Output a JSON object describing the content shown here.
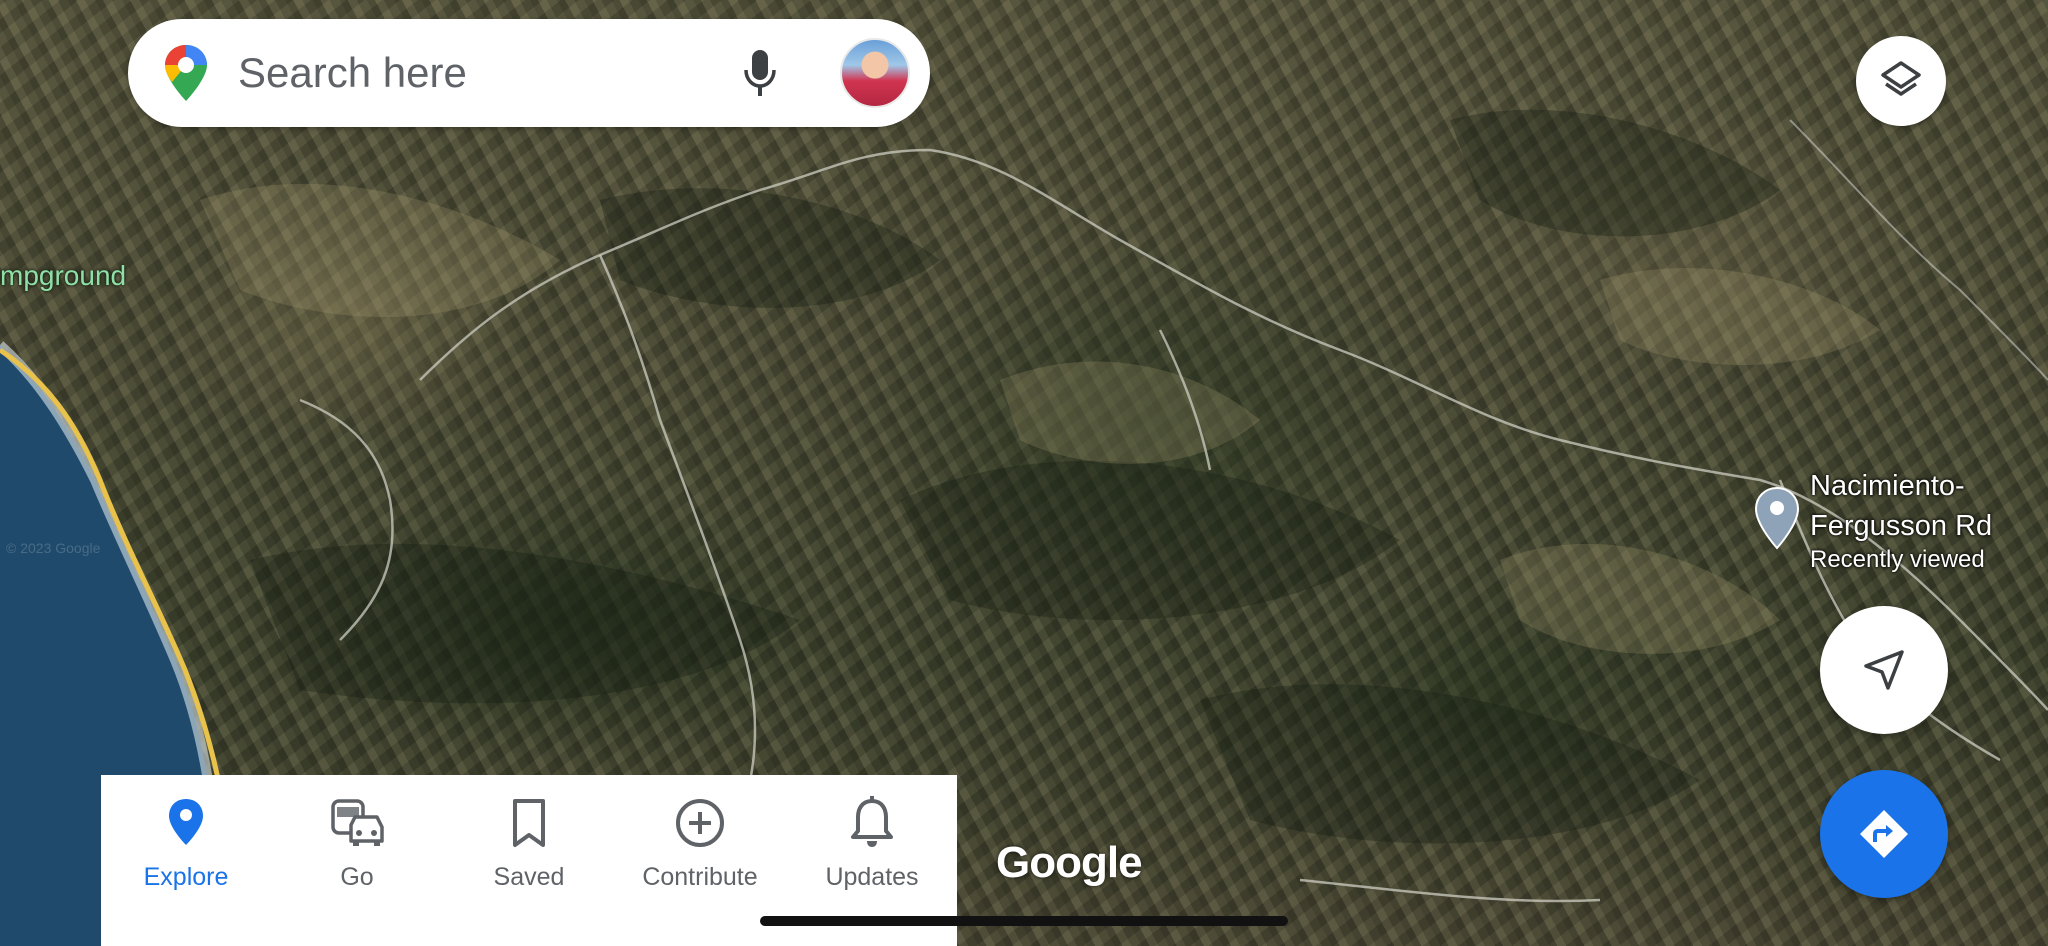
{
  "search": {
    "placeholder": "Search here",
    "logo_icon": "google-maps-pin-icon",
    "mic_icon": "microphone-icon"
  },
  "map": {
    "campground_label": "mpground",
    "copyright": "© 2023 Google",
    "google_wordmark": "Google",
    "place": {
      "name_line1": "Nacimiento-",
      "name_line2": "Fergusson Rd",
      "subtitle": "Recently viewed"
    }
  },
  "controls": {
    "layers_icon": "layers-icon",
    "location_icon": "navigation-arrow-icon",
    "directions_icon": "directions-icon"
  },
  "bottom_nav": {
    "items": [
      {
        "label": "Explore",
        "icon": "explore-pin-icon",
        "active": true
      },
      {
        "label": "Go",
        "icon": "commute-icon",
        "active": false
      },
      {
        "label": "Saved",
        "icon": "bookmark-icon",
        "active": false
      },
      {
        "label": "Contribute",
        "icon": "add-circle-icon",
        "active": false
      },
      {
        "label": "Updates",
        "icon": "bell-icon",
        "active": false
      }
    ]
  },
  "colors": {
    "accent": "#1a73e8",
    "inactive": "#5f6368",
    "campground_text": "#8fe0a6",
    "highway": "#e8c24a",
    "ocean": "#1f4a6b"
  }
}
